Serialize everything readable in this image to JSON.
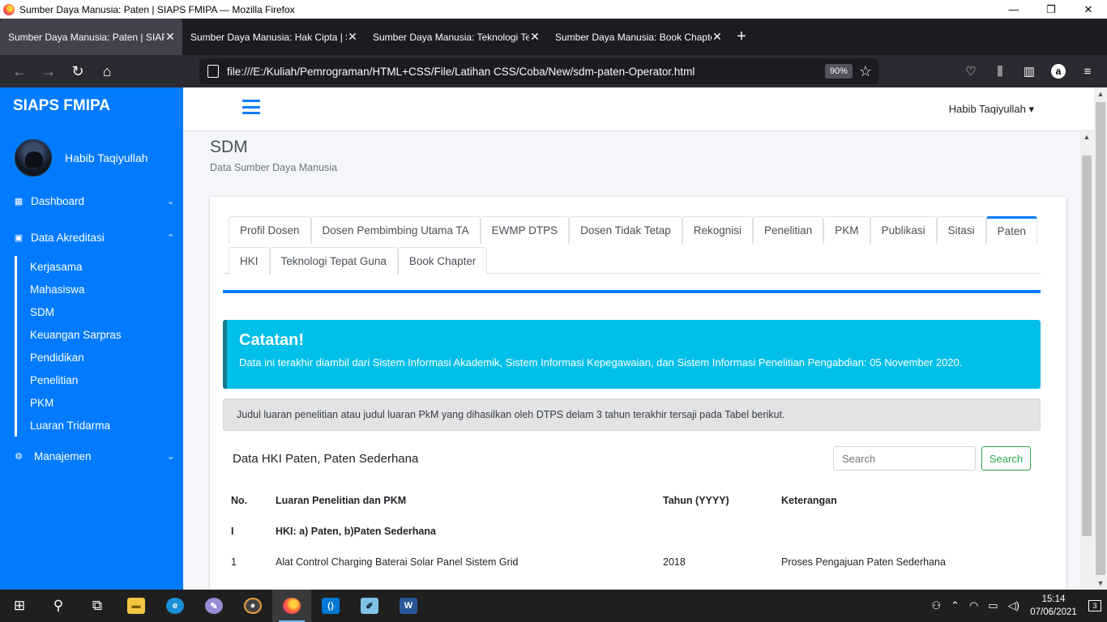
{
  "window": {
    "title": "Sumber Daya Manusia: Paten | SIAPS FMIPA — Mozilla Firefox",
    "minimize": "—",
    "restore": "❐",
    "close": "✕"
  },
  "browser_tabs": [
    {
      "label": "Sumber Daya Manusia: Paten | SIAPS",
      "active": true
    },
    {
      "label": "Sumber Daya Manusia: Hak Cipta | S",
      "active": false
    },
    {
      "label": "Sumber Daya Manusia: Teknologi Te",
      "active": false
    },
    {
      "label": "Sumber Daya Manusia: Book Chapte",
      "active": false
    }
  ],
  "navbar": {
    "url": "file:///E:/Kuliah/Pemrograman/HTML+CSS/File/Latihan CSS/Coba/New/sdm-paten-Operator.html",
    "zoom": "90%"
  },
  "sidebar": {
    "brand": "SIAPS FMIPA",
    "user_name": "Habib Taqiyullah",
    "menu": {
      "dashboard": "Dashboard",
      "data_akreditasi": "Data Akreditasi",
      "manajemen": "Manajemen"
    },
    "submenu": [
      "Kerjasama",
      "Mahasiswa",
      "SDM",
      "Keuangan Sarpras",
      "Pendidikan",
      "Penelitian",
      "PKM",
      "Luaran Tridarma"
    ]
  },
  "header": {
    "user": "Habib Taqiyullah ▾"
  },
  "page": {
    "title": "SDM",
    "subtitle": "Data Sumber Daya Manusia"
  },
  "content_tabs_row1": [
    "Profil Dosen",
    "Dosen Pembimbing Utama TA",
    "EWMP DTPS",
    "Dosen Tidak Tetap",
    "Rekognisi",
    "Penelitian",
    "PKM",
    "Publikasi",
    "Sitasi",
    "Paten"
  ],
  "content_tabs_row2": [
    "HKI",
    "Teknologi Tepat Guna",
    "Book Chapter"
  ],
  "active_tab": "Paten",
  "callout": {
    "title": "Catatan!",
    "text": "Data ini terakhir diambil dari Sistem Informasi Akademik, Sistem Informasi Kepegawaian, dan Sistem Informasi Penelitian Pengabdian: 05 November 2020."
  },
  "info_text": "Judul luaran penelitian atau judul luaran PkM yang dihasilkan oleh DTPS delam 3 tahun terakhir tersaji pada Tabel berikut.",
  "table": {
    "title": "Data HKI Paten, Paten Sederhana",
    "search_placeholder": "Search",
    "search_button": "Search",
    "headers": [
      "No.",
      "Luaran Penelitian dan PKM",
      "Tahun (YYYY)",
      "Keterangan"
    ],
    "section": {
      "no": "I",
      "label": "HKI: a) Paten, b)Paten Sederhana"
    },
    "rows": [
      {
        "no": "1",
        "luaran": "Alat Control Charging Baterai Solar Panel Sistem Grid",
        "tahun": "2018",
        "keterangan": "Proses Pengajuan Paten Sederhana"
      }
    ]
  },
  "taskbar": {
    "time": "15:14",
    "date": "07/06/2021",
    "notifications": "3"
  },
  "colors": {
    "primary": "#007bff",
    "info": "#00bfe8",
    "success": "#28a745"
  }
}
